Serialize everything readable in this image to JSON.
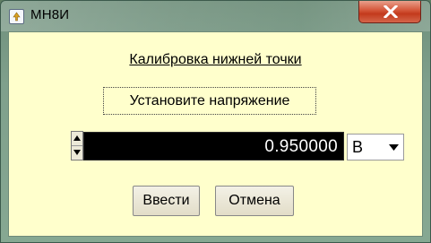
{
  "window": {
    "title": "МН8И"
  },
  "dialog": {
    "heading": "Калибровка нижней точки",
    "prompt": "Установите напряжение",
    "value": "0.950000",
    "unit": "В",
    "ok_label": "Ввести",
    "cancel_label": "Отмена"
  },
  "icons": {
    "app": "app-icon",
    "close": "close-icon",
    "spin_up": "arrow-up-icon",
    "spin_down": "arrow-down-icon",
    "dropdown": "chevron-down-icon"
  },
  "colors": {
    "client_background": "#ffffcc",
    "value_field_background": "#000000",
    "value_text": "#ffffff",
    "close_button": "#c33a1c"
  }
}
